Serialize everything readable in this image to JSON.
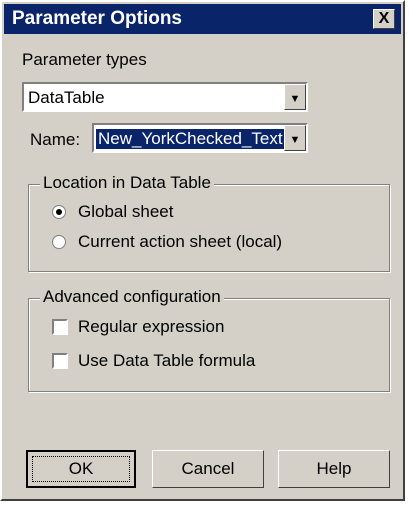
{
  "window": {
    "title": "Parameter Options",
    "close_glyph": "X"
  },
  "parameter_types": {
    "label": "Parameter types",
    "selected": "DataTable",
    "arrow_icon": "chevron-down-icon"
  },
  "name": {
    "label": "Name:",
    "value": "New_YorkChecked_Text"
  },
  "location_group": {
    "legend": "Location in Data Table",
    "options": [
      {
        "label": "Global sheet",
        "selected": true
      },
      {
        "label": "Current action sheet (local)",
        "selected": false
      }
    ]
  },
  "advanced_group": {
    "legend": "Advanced configuration",
    "options": [
      {
        "label": "Regular expression",
        "checked": false
      },
      {
        "label": "Use Data Table formula",
        "checked": false
      }
    ]
  },
  "buttons": {
    "ok": "OK",
    "cancel": "Cancel",
    "help": "Help"
  }
}
